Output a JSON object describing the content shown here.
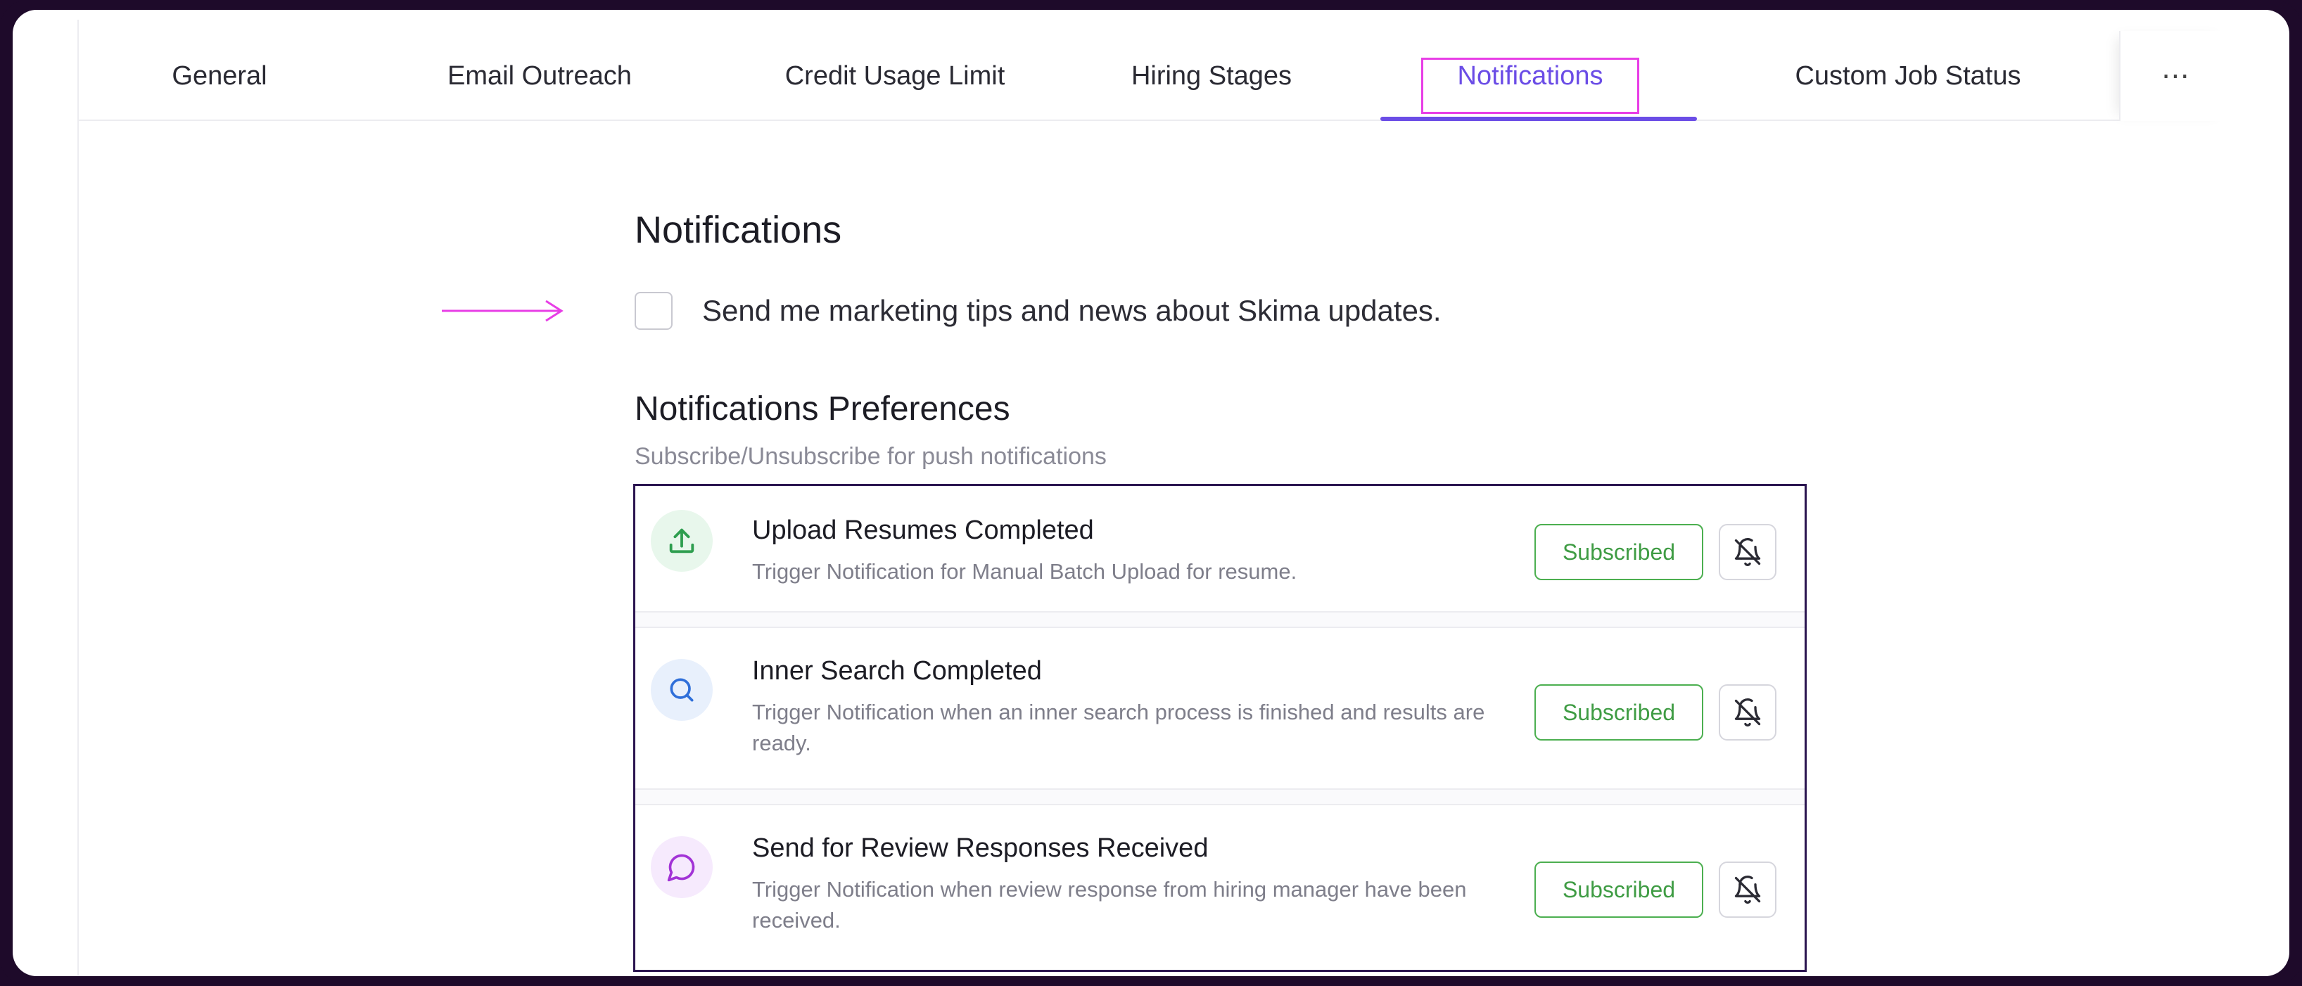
{
  "tabs": [
    {
      "label": "General"
    },
    {
      "label": "Email Outreach"
    },
    {
      "label": "Credit Usage Limit"
    },
    {
      "label": "Hiring Stages"
    },
    {
      "label": "Notifications"
    },
    {
      "label": "Custom Job Status"
    }
  ],
  "more_menu": {
    "label": "⋯",
    "icon": "ellipsis-icon"
  },
  "active_tab": "Notifications",
  "page": {
    "title": "Notifications",
    "marketing_checkbox": {
      "label": "Send me marketing tips and news about Skima updates.",
      "checked": false
    },
    "preferences_title": "Notifications Preferences",
    "preferences_subtitle": "Subscribe/Unsubscribe for push notifications"
  },
  "notifications": [
    {
      "icon": "upload-icon",
      "title": "Upload Resumes Completed",
      "description": "Trigger Notification for Manual Batch Upload for resume.",
      "status": "Subscribed",
      "mute_icon": "bell-off-icon"
    },
    {
      "icon": "search-icon",
      "title": "Inner Search Completed",
      "description": "Trigger Notification when an inner search process is finished and results are ready.",
      "status": "Subscribed",
      "mute_icon": "bell-off-icon"
    },
    {
      "icon": "chat-icon",
      "title": "Send for Review Responses Received",
      "description": "Trigger Notification when review response from hiring manager have been received.",
      "status": "Subscribed",
      "mute_icon": "bell-off-icon"
    }
  ],
  "colors": {
    "accent": "#6b4de6",
    "highlight": "#e83ee6",
    "subscribed": "#4caf50",
    "frame": "#1e0a2a"
  }
}
